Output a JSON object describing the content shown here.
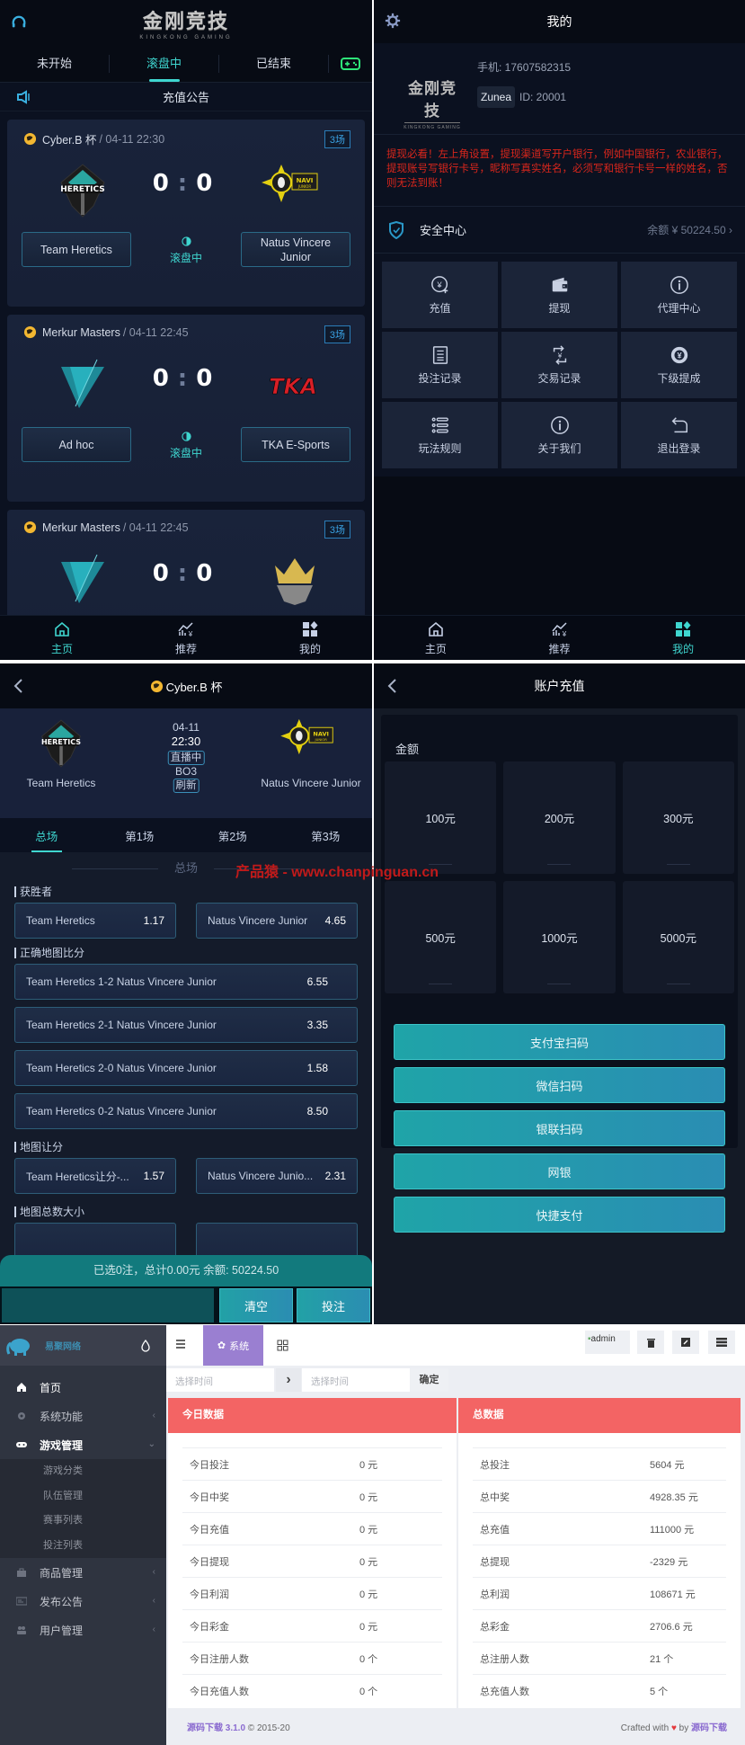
{
  "home": {
    "logo_cn": "金刚竞技",
    "logo_en": "KINGKONG GAMING",
    "tabs": [
      "未开始",
      "滚盘中",
      "已结束"
    ],
    "active_tab": "滚盘中",
    "notice": "充值公告",
    "matches": [
      {
        "league": "Cyber.B 杯",
        "sep": " / ",
        "time": "04-11 22:30",
        "rounds": "3场",
        "home_score": "0",
        "away_score": "0",
        "home": "Team Heretics",
        "away": "Natus Vincere Junior",
        "status": "滚盘中"
      },
      {
        "league": "Merkur Masters",
        "sep": " / ",
        "time": "04-11 22:45",
        "rounds": "3场",
        "home_score": "0",
        "away_score": "0",
        "home": "Ad hoc",
        "away": "TKA E-Sports",
        "status": "滚盘中"
      },
      {
        "league": "Merkur Masters",
        "sep": " / ",
        "time": "04-11 22:45",
        "rounds": "3场",
        "home_score": "0",
        "away_score": "0"
      }
    ]
  },
  "tabbar": [
    {
      "label": "主页",
      "icon": "home-icon"
    },
    {
      "label": "推荐",
      "icon": "trend-icon"
    },
    {
      "label": "我的",
      "icon": "apps-icon"
    }
  ],
  "mine": {
    "title": "我的",
    "logo_cn": "金刚竞技",
    "logo_en": "KINGKONG GAMING",
    "phone": "手机: 17607582315",
    "nickname": "Zunea",
    "uid": "ID: 20001",
    "warning": "提现必看！左上角设置，提现渠道写开户银行，例如中国银行，农业银行，提现账号写银行卡号，昵称写真实姓名，必须写和银行卡号一样的姓名，否则无法到账！",
    "security_label": "安全中心",
    "balance": "余额 ¥ 50224.50",
    "grid": [
      {
        "label": "充值",
        "icon": "recharge-icon"
      },
      {
        "label": "提现",
        "icon": "wallet-icon"
      },
      {
        "label": "代理中心",
        "icon": "info-icon"
      },
      {
        "label": "投注记录",
        "icon": "document-icon"
      },
      {
        "label": "交易记录",
        "icon": "exchange-icon"
      },
      {
        "label": "下级提成",
        "icon": "commission-icon"
      },
      {
        "label": "玩法规则",
        "icon": "list-icon"
      },
      {
        "label": "关于我们",
        "icon": "info-icon"
      },
      {
        "label": "退出登录",
        "icon": "logout-icon"
      }
    ]
  },
  "detail": {
    "league": "Cyber.B 杯",
    "home": "Team Heretics",
    "away": "Natus Vincere Junior",
    "date": "04-11",
    "time": "22:30",
    "live_tag": "直播中",
    "format": "BO3",
    "refresh": "刷新",
    "tabs": [
      "总场",
      "第1场",
      "第2场",
      "第3场"
    ],
    "section": "总场",
    "groups": {
      "winner": {
        "label": "获胜者",
        "options": [
          {
            "name": "Team Heretics",
            "odds": "1.17"
          },
          {
            "name": "Natus Vincere Junior",
            "odds": "4.65"
          }
        ]
      },
      "correct_score": {
        "label": "正确地图比分",
        "options": [
          {
            "name": "Team Heretics 1-2 Natus Vincere Junior",
            "odds": "6.55"
          },
          {
            "name": "Team Heretics 2-1 Natus Vincere Junior",
            "odds": "3.35"
          },
          {
            "name": "Team Heretics 2-0 Natus Vincere Junior",
            "odds": "1.58"
          },
          {
            "name": "Team Heretics 0-2 Natus Vincere Junior",
            "odds": "8.50"
          }
        ]
      },
      "handicap": {
        "label": "地图让分",
        "options": [
          {
            "name": "Team Heretics让分-...",
            "odds": "1.57"
          },
          {
            "name": "Natus Vincere Junio...",
            "odds": "2.31"
          }
        ]
      },
      "total": {
        "label": "地图总数大小"
      }
    },
    "bet_summary": "已选0注，总计0.00元 余额: 50224.50",
    "clear_label": "清空",
    "bet_label": "投注"
  },
  "recharge": {
    "title": "账户充值",
    "amount_label": "金额",
    "amounts": [
      "100元",
      "200元",
      "300元",
      "500元",
      "1000元",
      "5000元"
    ],
    "methods": [
      "支付宝扫码",
      "微信扫码",
      "银联扫码",
      "网银",
      "快捷支付"
    ]
  },
  "admin": {
    "brand": "易聚网络",
    "system_tab": "系统",
    "admin_alt": "admin",
    "menu": [
      {
        "label": "首页",
        "icon": "home-icon"
      },
      {
        "label": "系统功能",
        "icon": "gear-icon"
      },
      {
        "label": "游戏管理",
        "icon": "gamepad-icon"
      },
      {
        "label": "商品管理",
        "icon": "bag-icon"
      },
      {
        "label": "发布公告",
        "icon": "card-icon"
      },
      {
        "label": "用户管理",
        "icon": "users-icon"
      }
    ],
    "submenu": [
      "游戏分类",
      "队伍管理",
      "赛事列表",
      "投注列表"
    ],
    "date_placeholder": "选择时间",
    "confirm": "确定",
    "today_title": "今日数据",
    "total_title": "总数据",
    "today": [
      {
        "k": "今日投注",
        "v": "0 元"
      },
      {
        "k": "今日中奖",
        "v": "0 元"
      },
      {
        "k": "今日充值",
        "v": "0 元"
      },
      {
        "k": "今日提现",
        "v": "0 元"
      },
      {
        "k": "今日利润",
        "v": "0 元"
      },
      {
        "k": "今日彩金",
        "v": "0 元"
      },
      {
        "k": "今日注册人数",
        "v": "0 个"
      },
      {
        "k": "今日充值人数",
        "v": "0 个"
      }
    ],
    "total": [
      {
        "k": "总投注",
        "v": "5604 元"
      },
      {
        "k": "总中奖",
        "v": "4928.35 元"
      },
      {
        "k": "总充值",
        "v": "111000 元"
      },
      {
        "k": "总提现",
        "v": "-2329 元"
      },
      {
        "k": "总利润",
        "v": "108671 元"
      },
      {
        "k": "总彩金",
        "v": "2706.6 元"
      },
      {
        "k": "总注册人数",
        "v": "21 个"
      },
      {
        "k": "总充值人数",
        "v": "5 个"
      }
    ],
    "footer_brand": "源码下载 3.1.0",
    "footer_copy": " © 2015-20",
    "crafted": "Crafted with",
    "by": "by",
    "crafted_brand": "源码下载"
  },
  "colors": {
    "accent": "#3fd6d0",
    "badge": "#3aa2e4",
    "warning": "#d9261c",
    "admin_header": "#f36464",
    "admin_tab": "#9a7fd1"
  }
}
